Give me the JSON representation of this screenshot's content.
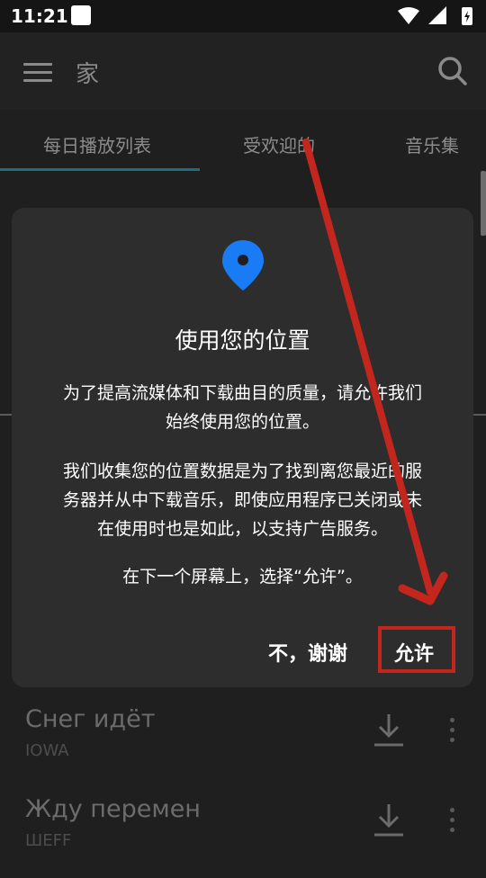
{
  "status_bar": {
    "time": "11:21"
  },
  "app_bar": {
    "title": "家"
  },
  "tabs": [
    {
      "label": "每日播放列表",
      "active": true
    },
    {
      "label": "受欢迎的",
      "active": false
    },
    {
      "label": "音乐集",
      "active": false
    }
  ],
  "dialog": {
    "icon": "location-pin-icon",
    "title": "使用您的位置",
    "paragraph1_line1": "为了提高流媒体和下载曲目的质量，请允许我们",
    "paragraph1_line2": "始终使用您的位置。",
    "paragraph2_line1": "我们收集您的位置数据是为了找到离您最近的服",
    "paragraph2_line2": "务器并从中下载音乐，即使应用程序已关闭或未",
    "paragraph2_line3": "在使用时也是如此，以支持广告服务。",
    "paragraph3": "在下一个屏幕上，选择“允许”。",
    "deny_label": "不，谢谢",
    "allow_label": "允许"
  },
  "songs": [
    {
      "title": "Снег идёт",
      "artist": "IOWA"
    },
    {
      "title": "Жду перемен",
      "artist": "ШЕFF"
    }
  ],
  "colors": {
    "accent": "#1e6e7b",
    "pin_blue": "#1a7cf5",
    "annotation_red": "#c3261c"
  }
}
